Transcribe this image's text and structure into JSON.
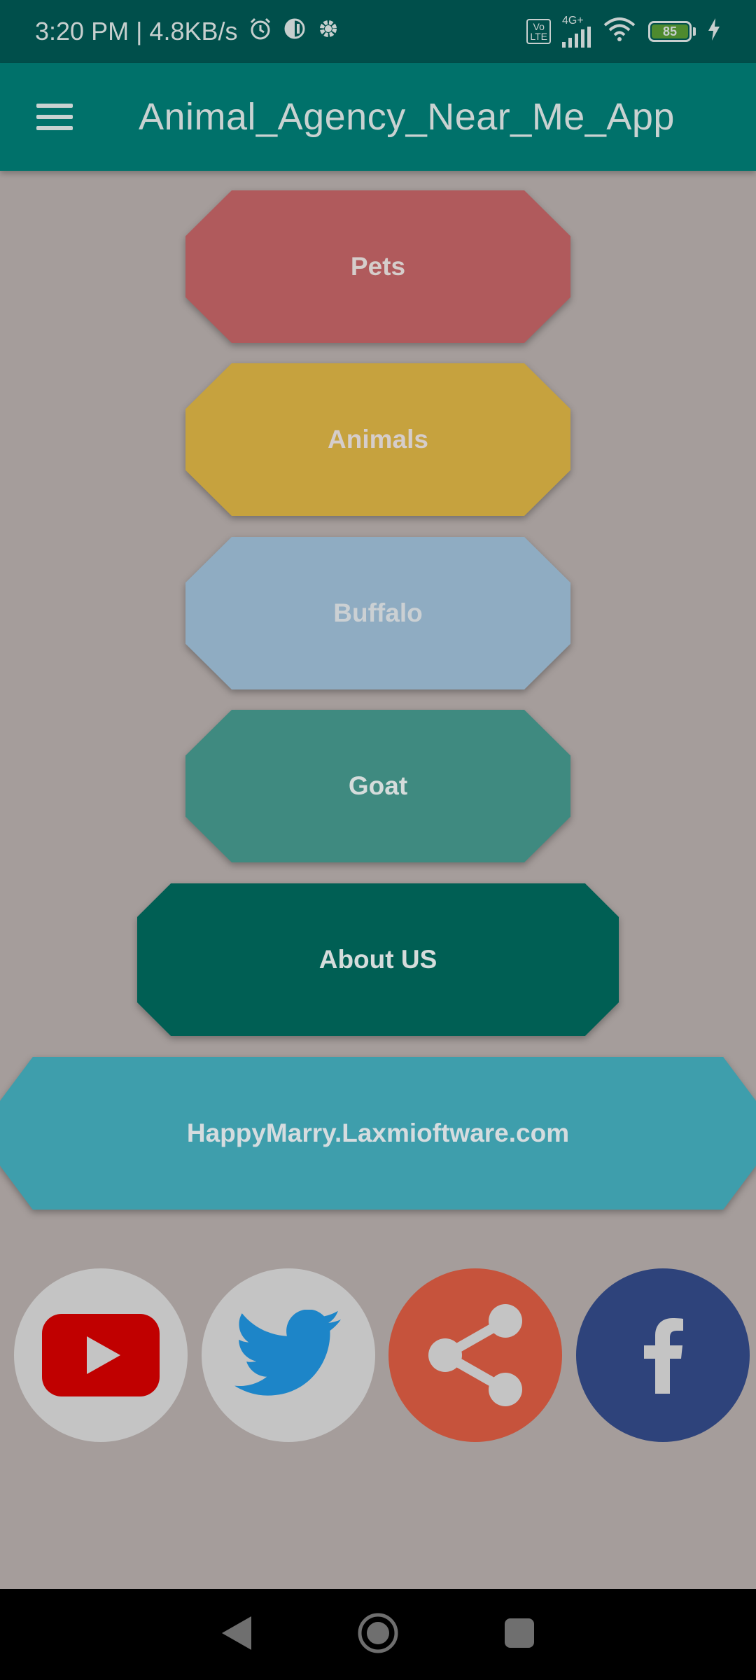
{
  "status_bar": {
    "time_speed": "3:20 PM | 4.8KB/s",
    "network": "4G+",
    "volte": "Vo\nLTE",
    "battery": "85"
  },
  "app_bar": {
    "title": "Animal_Agency_Near_Me_App"
  },
  "buttons": [
    {
      "label": "Pets",
      "color": "#b05a5c",
      "text_color": "#d5cdcb"
    },
    {
      "label": "Animals",
      "color": "#c6a23e",
      "text_color": "#d5cdcb"
    },
    {
      "label": "Buffalo",
      "color": "#8facc2",
      "text_color": "#cbd0d3"
    },
    {
      "label": "Goat",
      "color": "#3f8a80",
      "text_color": "#d5dcdb"
    },
    {
      "label": "About US",
      "color": "#005f54",
      "text_color": "#d5dcdb"
    },
    {
      "label": "HappyMarry.Laxmioftware.com",
      "color": "#3e9eac",
      "text_color": "#d5dcdf"
    }
  ],
  "social": [
    {
      "icon": "youtube-icon",
      "bg": "#c4c4c4",
      "accent": "#c00000"
    },
    {
      "icon": "twitter-icon",
      "bg": "#c4c4c4",
      "accent": "#1d85c8"
    },
    {
      "icon": "share-icon",
      "bg": "#c6533c",
      "accent": "#c4c4c4"
    },
    {
      "icon": "facebook-icon",
      "bg": "#2e437b",
      "accent": "#c4c4c4"
    }
  ]
}
